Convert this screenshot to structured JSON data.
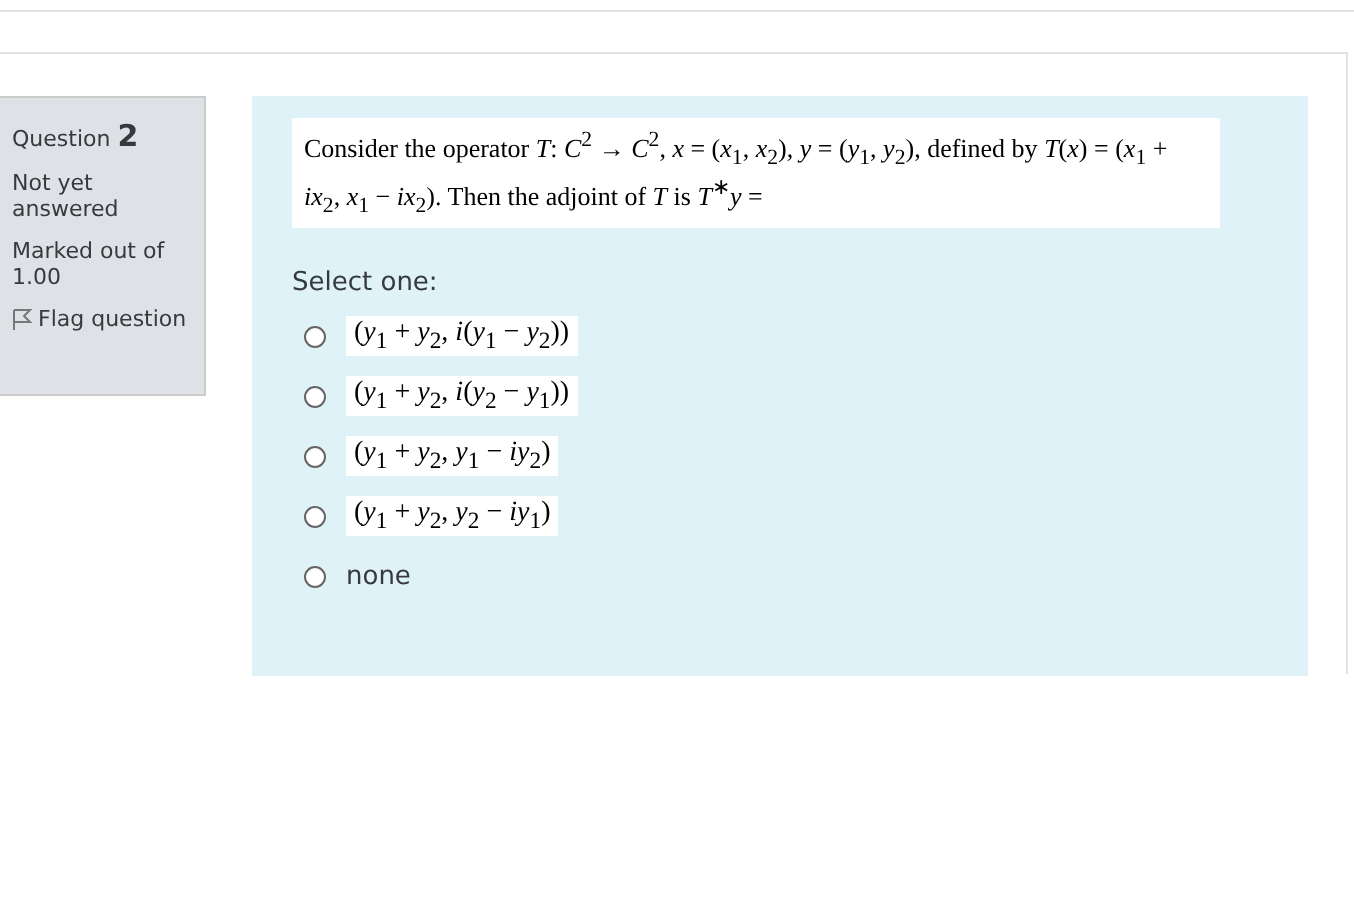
{
  "question_info": {
    "label": "Question",
    "number": "2",
    "status": "Not yet answered",
    "marks": "Marked out of 1.00",
    "flag": "Flag question"
  },
  "question": {
    "text": "Consider the operator *T*: *C*$^{2}$ → *C*$^{2}$, *x* = (*x*$_{1}$, *x*$_{2}$), *y* = (*y*$_{1}$, *y*$_{2}$), defined by *T*(*x*) = (*x*$_{1}$ + *ix*$_{2}$, *x*$_{1}$ − *ix*$_{2}$). Then the adjoint of *T* is *T*$^{∗}$*y* =",
    "prompt": "Select one:",
    "options": [
      {
        "kind": "math",
        "label": "(*y*$_{1}$ + *y*$_{2}$, *i*(*y*$_{1}$ − *y*$_{2}$))",
        "selected": false
      },
      {
        "kind": "math",
        "label": "(*y*$_{1}$ + *y*$_{2}$, *i*(*y*$_{2}$ − *y*$_{1}$))",
        "selected": false
      },
      {
        "kind": "math",
        "label": "(*y*$_{1}$ + *y*$_{2}$, *y*$_{1}$ − *iy*$_{2}$)",
        "selected": false
      },
      {
        "kind": "math",
        "label": "(*y*$_{1}$ + *y*$_{2}$, *y*$_{2}$ − *iy*$_{1}$)",
        "selected": false
      },
      {
        "kind": "text",
        "label": "none",
        "selected": false
      }
    ]
  }
}
